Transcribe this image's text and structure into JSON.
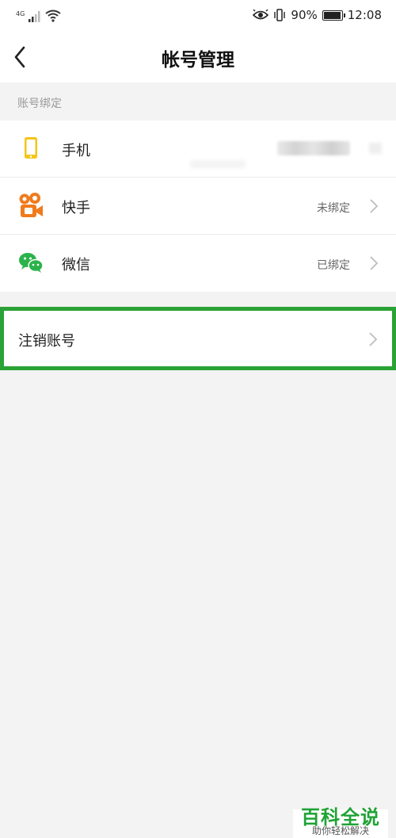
{
  "status_bar": {
    "network": "4G",
    "battery": "90%",
    "battery_level": 0.9,
    "time": "12:08"
  },
  "header": {
    "title": "帐号管理"
  },
  "section": {
    "title": "账号绑定"
  },
  "bindings": [
    {
      "label": "手机",
      "status": "",
      "icon": "phone-icon"
    },
    {
      "label": "快手",
      "status": "未绑定",
      "icon": "kuaishou-icon"
    },
    {
      "label": "微信",
      "status": "已绑定",
      "icon": "wechat-icon"
    }
  ],
  "cancel_account": {
    "label": "注销账号"
  },
  "watermark": {
    "title": "百科全说",
    "subtitle": "助你轻松解决"
  },
  "colors": {
    "highlight": "#2aa236",
    "phone": "#f5c518",
    "kuaishou": "#f07b1d",
    "wechat": "#2bb34a"
  }
}
